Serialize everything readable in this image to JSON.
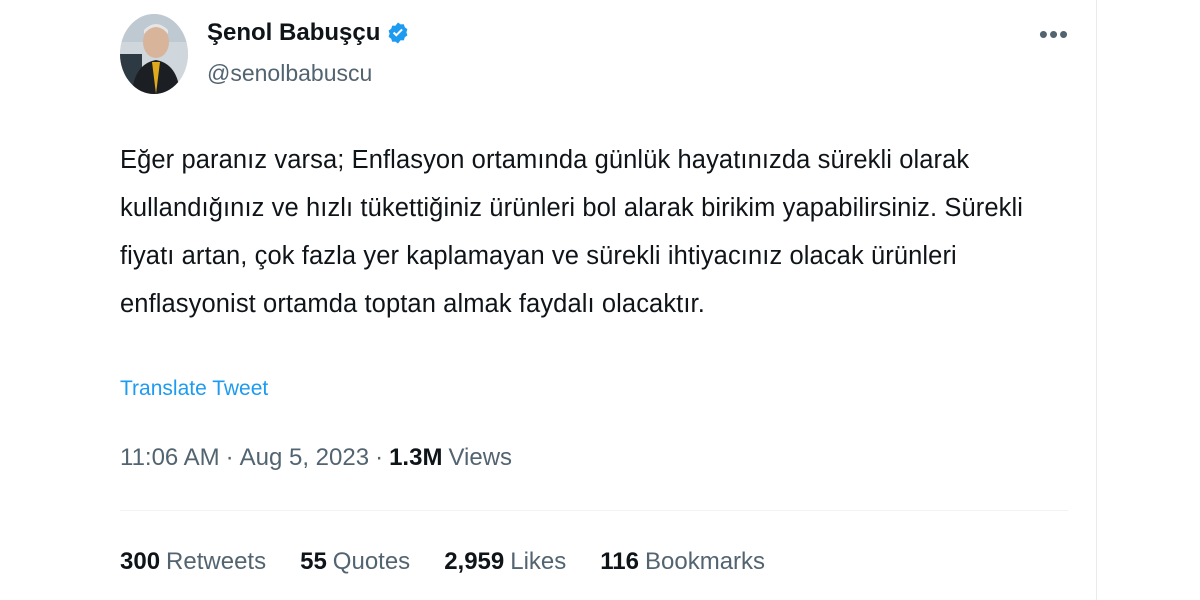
{
  "author": {
    "display_name": "Şenol Babuşçu",
    "handle": "@senolbabuscu",
    "verified_icon": "verified-badge-icon",
    "verified_color": "#1d9bf0"
  },
  "more_icon": "more-horizontal-icon",
  "more_glyph": "•••",
  "tweet": {
    "text": "Eğer paranız varsa; Enflasyon ortamında günlük hayatınızda sürekli olarak kullandığınız ve hızlı tükettiğiniz ürünleri bol alarak birikim yapabilirsiniz. Sürekli fiyatı artan, çok fazla yer kaplamayan ve sürekli ihtiyacınız olacak ürünleri enflasyonist ortamda toptan almak faydalı olacaktır.",
    "translate_label": "Translate Tweet",
    "time": "11:06 AM",
    "date": "Aug 5, 2023",
    "separator": "·",
    "views_count": "1.3M",
    "views_label": "Views"
  },
  "stats": [
    {
      "count": "300",
      "label": "Retweets"
    },
    {
      "count": "55",
      "label": "Quotes"
    },
    {
      "count": "2,959",
      "label": "Likes"
    },
    {
      "count": "116",
      "label": "Bookmarks"
    }
  ],
  "colors": {
    "link": "#1d9bf0",
    "secondary_text": "#536471",
    "primary_text": "#0f1419"
  }
}
